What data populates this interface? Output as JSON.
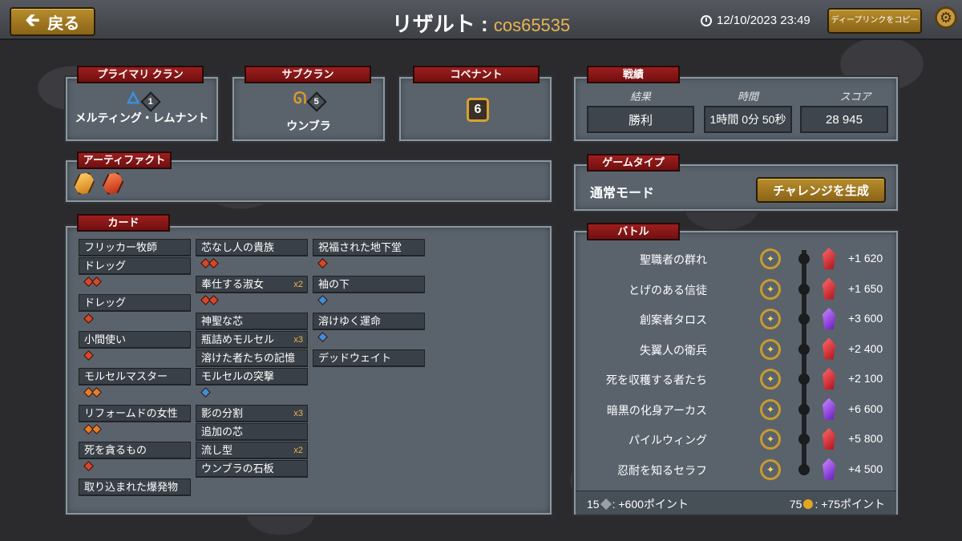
{
  "header": {
    "back_label": "戻る",
    "title": "リザルト :",
    "player": "cos65535",
    "datetime": "12/10/2023 23:49",
    "deeplink_label": "ディープリンクをコピー"
  },
  "primary_clan": {
    "tab": "プライマリ クラン",
    "name": "メルティング・レムナント",
    "level": "1"
  },
  "subclan": {
    "tab": "サブクラン",
    "name": "ウンブラ",
    "level": "5"
  },
  "covenant": {
    "tab": "コベナント",
    "level": "6"
  },
  "stats": {
    "tab": "戦績",
    "result_label": "結果",
    "time_label": "時間",
    "score_label": "スコア",
    "result": "勝利",
    "time": "1時間 0分 50秒",
    "score": "28 945"
  },
  "artifacts": {
    "tab": "アーティファクト"
  },
  "game_type": {
    "tab": "ゲームタイプ",
    "mode": "通常モード",
    "challenge_button": "チャレンジを生成"
  },
  "cards": {
    "tab": "カード",
    "col1": [
      {
        "name": "フリッカー牧師",
        "mult": "",
        "gems": []
      },
      {
        "name": "ドレッグ",
        "mult": "",
        "gems": [
          "red",
          "red"
        ]
      },
      {
        "name": "ドレッグ",
        "mult": "",
        "gems": [
          "red"
        ]
      },
      {
        "name": "小間使い",
        "mult": "",
        "gems": [
          "red"
        ]
      },
      {
        "name": "モルセルマスター",
        "mult": "",
        "gems": [
          "ora",
          "ora"
        ]
      },
      {
        "name": "リフォームドの女性",
        "mult": "",
        "gems": [
          "ora",
          "ora"
        ]
      },
      {
        "name": "死を貪るもの",
        "mult": "",
        "gems": [
          "red"
        ]
      },
      {
        "name": "取り込まれた爆発物",
        "mult": "",
        "gems": []
      }
    ],
    "col2": [
      {
        "name": "芯なし人の貴族",
        "mult": "",
        "gems": [
          "red",
          "red"
        ]
      },
      {
        "name": "奉仕する淑女",
        "mult": "x2",
        "gems": [
          "red",
          "red"
        ]
      },
      {
        "name": "神聖な芯",
        "mult": "",
        "gems": []
      },
      {
        "name": "瓶詰めモルセル",
        "mult": "x3",
        "gems": []
      },
      {
        "name": "溶けた者たちの記憶",
        "mult": "",
        "gems": []
      },
      {
        "name": "モルセルの突撃",
        "mult": "",
        "gems": [
          "blu"
        ]
      },
      {
        "name": "影の分割",
        "mult": "x3",
        "gems": []
      },
      {
        "name": "追加の芯",
        "mult": "",
        "gems": []
      },
      {
        "name": "流し型",
        "mult": "x2",
        "gems": []
      },
      {
        "name": "ウンブラの石板",
        "mult": "",
        "gems": []
      }
    ],
    "col3": [
      {
        "name": "祝福された地下堂",
        "mult": "",
        "gems": [
          "red"
        ]
      },
      {
        "name": "袖の下",
        "mult": "",
        "gems": [
          "blu"
        ]
      },
      {
        "name": "溶けゆく運命",
        "mult": "",
        "gems": [
          "blu"
        ]
      },
      {
        "name": "デッドウェイト",
        "mult": "",
        "gems": []
      }
    ]
  },
  "battle": {
    "tab": "バトル",
    "rows": [
      {
        "name": "聖職者の群れ",
        "score": "+1 620",
        "crystal": "red"
      },
      {
        "name": "とげのある信徒",
        "score": "+1 650",
        "crystal": "red"
      },
      {
        "name": "創案者タロス",
        "score": "+3 600",
        "crystal": "purple"
      },
      {
        "name": "失翼人の衛兵",
        "score": "+2 400",
        "crystal": "red"
      },
      {
        "name": "死を収穫する者たち",
        "score": "+2 100",
        "crystal": "red"
      },
      {
        "name": "暗黒の化身アーカス",
        "score": "+6 600",
        "crystal": "purple"
      },
      {
        "name": "パイルウィング",
        "score": "+5 800",
        "crystal": "red"
      },
      {
        "name": "忍耐を知るセラフ",
        "score": "+4 500",
        "crystal": "purple"
      }
    ],
    "footer_left_count": "15",
    "footer_left": ": +600ポイント",
    "footer_right_count": "75",
    "footer_right": ": +75ポイント"
  },
  "colors": {
    "accent_gold": "#e8b551",
    "tab_red": "#8a1616",
    "panel": "#5a636c"
  }
}
